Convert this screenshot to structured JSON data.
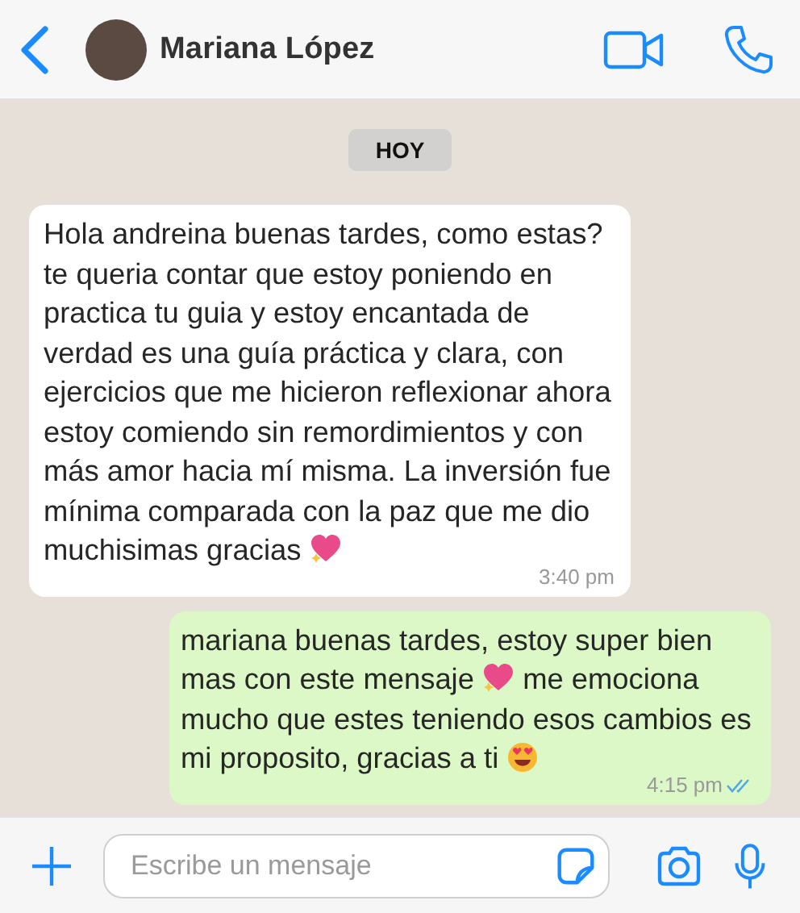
{
  "header": {
    "contact_name": "Mariana López"
  },
  "date_chip": "HOY",
  "messages": [
    {
      "kind": "received",
      "time": "3:40 pm",
      "parts": [
        {
          "kind": "text",
          "text": "Hola andreina buenas tardes, como estas? te queria contar que estoy poniendo en practica tu guia y estoy encantada de verdad es una guía práctica y clara, con ejercicios que me hicieron reflexionar ahora estoy comiendo sin remordimientos y con más amor hacia mí misma. La inversión fue mínima comparada con la paz que me dio muchisimas gracias "
        },
        {
          "kind": "heart"
        }
      ]
    },
    {
      "kind": "sent",
      "time": "4:15 pm",
      "read": true,
      "parts": [
        {
          "kind": "text",
          "text": "mariana buenas tardes, estoy super bien mas con este mensaje "
        },
        {
          "kind": "heart"
        },
        {
          "kind": "text",
          "text": "  me emociona mucho que estes teniendo esos cambios es mi proposito, gracias a ti "
        },
        {
          "kind": "smile"
        }
      ]
    }
  ],
  "composer": {
    "placeholder": "Escribe un mensaje"
  }
}
